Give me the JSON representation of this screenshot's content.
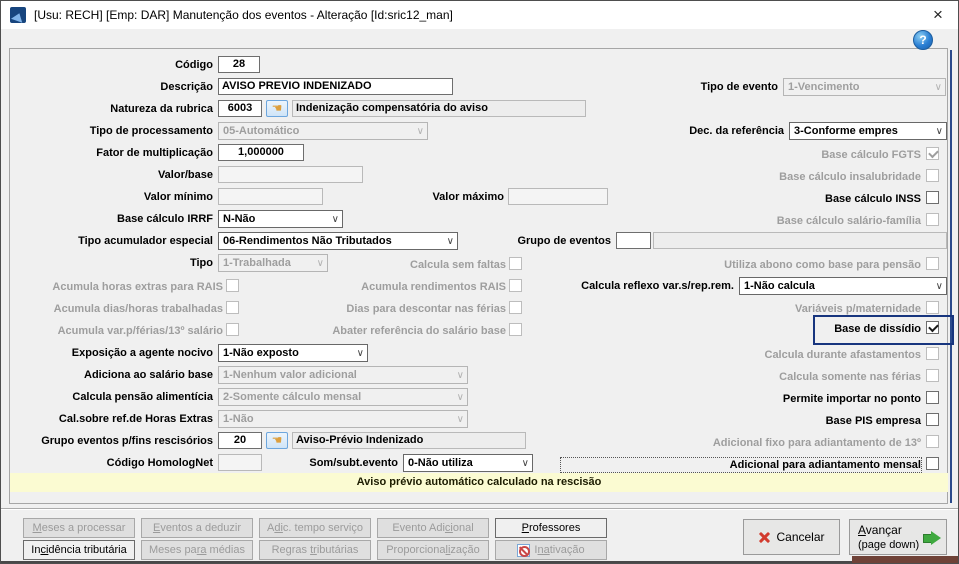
{
  "icons": {
    "chevron": "∨",
    "help": "?",
    "lookup": "☚",
    "close": "×"
  },
  "window": {
    "title": "[Usu: RECH] [Emp: DAR] Manutenção dos eventos - Alteração [Id:sric12_man]"
  },
  "fields": {
    "codigo": {
      "label": "Código",
      "value": "28"
    },
    "descricao": {
      "label": "Descrição",
      "value": "AVISO PREVIO INDENIZADO"
    },
    "tipo_evento": {
      "label": "Tipo de evento",
      "value": "1-Vencimento"
    },
    "natureza": {
      "label": "Natureza da rubrica",
      "code": "6003",
      "desc": "Indenização compensatória do aviso"
    },
    "tipo_processamento": {
      "label": "Tipo de processamento",
      "value": "05-Automático"
    },
    "dec_referencia": {
      "label": "Dec. da referência",
      "value": "3-Conforme empres"
    },
    "fator": {
      "label": "Fator de multiplicação",
      "value": "1,000000"
    },
    "valor_base": {
      "label": "Valor/base",
      "value": ""
    },
    "valor_minimo": {
      "label": "Valor mínimo",
      "value": ""
    },
    "valor_maximo": {
      "label": "Valor máximo",
      "value": ""
    },
    "base_irrf": {
      "label": "Base cálculo IRRF",
      "value": "N-Não"
    },
    "tipo_acumulador": {
      "label": "Tipo acumulador especial",
      "value": "06-Rendimentos Não Tributados"
    },
    "grupo_eventos": {
      "label": "Grupo de eventos",
      "value": "",
      "desc": ""
    },
    "tipo": {
      "label": "Tipo",
      "value": "1-Trabalhada"
    },
    "calcula_reflexo": {
      "label": "Calcula reflexo var.s/rep.rem.",
      "value": "1-Não calcula"
    },
    "exposicao": {
      "label": "Exposição a agente nocivo",
      "value": "1-Não exposto"
    },
    "adiciona_salario": {
      "label": "Adiciona ao salário base",
      "value": "1-Nenhum valor adicional"
    },
    "pensao": {
      "label": "Calcula pensão alimentícia",
      "value": "2-Somente cálculo mensal"
    },
    "cal_he": {
      "label": "Cal.sobre ref.de Horas Extras",
      "value": "1-Não"
    },
    "grupo_rescisorios": {
      "label": "Grupo eventos p/fins rescisórios",
      "code": "20",
      "desc": "Aviso-Prévio Indenizado"
    },
    "homolognet": {
      "label": "Código HomologNet",
      "value": ""
    },
    "som_subt": {
      "label": "Som/subt.evento",
      "value": "0-Não utiliza"
    }
  },
  "checks": {
    "fgts": {
      "label": "Base cálculo FGTS",
      "checked": true,
      "enabled": false
    },
    "insalubridade": {
      "label": "Base cálculo insalubridade",
      "checked": false,
      "enabled": false
    },
    "inss": {
      "label": "Base cálculo INSS",
      "checked": false,
      "enabled": true
    },
    "salario_familia": {
      "label": "Base cálculo salário-família",
      "checked": false,
      "enabled": false
    },
    "calcula_sem_faltas": {
      "label": "Calcula sem faltas",
      "checked": false,
      "enabled": false
    },
    "utiliza_abono": {
      "label": "Utiliza abono como base para pensão",
      "checked": false,
      "enabled": false
    },
    "acum_he_rais": {
      "label": "Acumula horas extras para RAIS",
      "checked": false,
      "enabled": false
    },
    "acum_rend_rais": {
      "label": "Acumula rendimentos RAIS",
      "checked": false,
      "enabled": false
    },
    "acum_dias": {
      "label": "Acumula dias/horas trabalhadas",
      "checked": false,
      "enabled": false
    },
    "dias_descontar": {
      "label": "Dias para descontar nas férias",
      "checked": false,
      "enabled": false
    },
    "variaveis_mat": {
      "label": "Variáveis p/maternidade",
      "checked": false,
      "enabled": false
    },
    "acum_var": {
      "label": "Acumula var.p/férias/13º salário",
      "checked": false,
      "enabled": false
    },
    "abater_ref": {
      "label": "Abater referência do salário base",
      "checked": false,
      "enabled": false
    },
    "base_dissidio": {
      "label": "Base de dissídio",
      "checked": true,
      "enabled": true
    },
    "calcula_durante": {
      "label": "Calcula durante afastamentos",
      "checked": false,
      "enabled": false
    },
    "calcula_somente": {
      "label": "Calcula somente nas férias",
      "checked": false,
      "enabled": false
    },
    "permite_importar": {
      "label": "Permite importar no ponto",
      "checked": false,
      "enabled": true
    },
    "base_pis": {
      "label": "Base PIS empresa",
      "checked": false,
      "enabled": true
    },
    "adicional_fixo": {
      "label": "Adicional fixo para adiantamento de 13º",
      "checked": false,
      "enabled": false
    },
    "adicional_mensal": {
      "label": "Adicional para adiantamento mensal",
      "checked": false,
      "enabled": true
    }
  },
  "message": "Aviso prévio automático calculado na rescisão",
  "tabs": {
    "row1": [
      {
        "pre": "",
        "mn": "M",
        "post": "eses a processar",
        "enabled": false
      },
      {
        "pre": "",
        "mn": "E",
        "post": "ventos a deduzir",
        "enabled": false
      },
      {
        "pre": "A",
        "mn": "di",
        "post": "c. tempo serviço",
        "enabled": false
      },
      {
        "pre": "Evento Adi",
        "mn": "ci",
        "post": "onal",
        "enabled": false
      },
      {
        "pre": "",
        "mn": "P",
        "post": "rofessores",
        "enabled": true
      }
    ],
    "row2": [
      {
        "pre": "In",
        "mn": "ci",
        "post": "dência tributária",
        "enabled": true
      },
      {
        "pre": "Meses pa",
        "mn": "ra",
        "post": " médias",
        "enabled": false
      },
      {
        "pre": "Regras ",
        "mn": "tr",
        "post": "ibutárias",
        "enabled": false
      },
      {
        "pre": "Proporciona",
        "mn": "li",
        "post": "zação",
        "enabled": false
      },
      {
        "pre": "I",
        "mn": "na",
        "post": "tivação",
        "enabled": false
      }
    ]
  },
  "actions": {
    "cancel": "Cancelar",
    "advance_mn": "A",
    "advance_rest": "vançar",
    "advance_line2": "(page down)"
  }
}
